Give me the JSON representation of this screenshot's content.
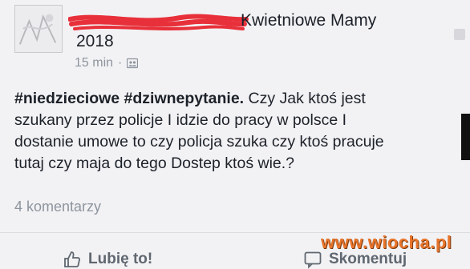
{
  "post": {
    "author_visible_tail": "Kwietniowe Mamy",
    "author_year": "2018",
    "time": "15 min",
    "separator": "·",
    "audience_icon": "group-audience-icon",
    "hashtags": "#niedzieciowe #dziwnepytanie.",
    "body_line1_rest": "  Czy Jak ktoś jest",
    "body_line2": "szukany przez policje I idzie do pracy w polsce I",
    "body_line3": "dostanie umowe to czy policja szuka czy ktoś pracuje",
    "body_line4": "tutaj czy maja do tego Dostep ktoś wie.?",
    "comments_count": "4 komentarzy"
  },
  "actions": {
    "like_label": "Lubię to!",
    "comment_label": "Skomentuj"
  },
  "watermark": "www.wiocha.pl",
  "colors": {
    "redaction": "#e8303a",
    "text": "#1d2129",
    "muted": "#8d949e",
    "watermark": "#e8742a"
  }
}
